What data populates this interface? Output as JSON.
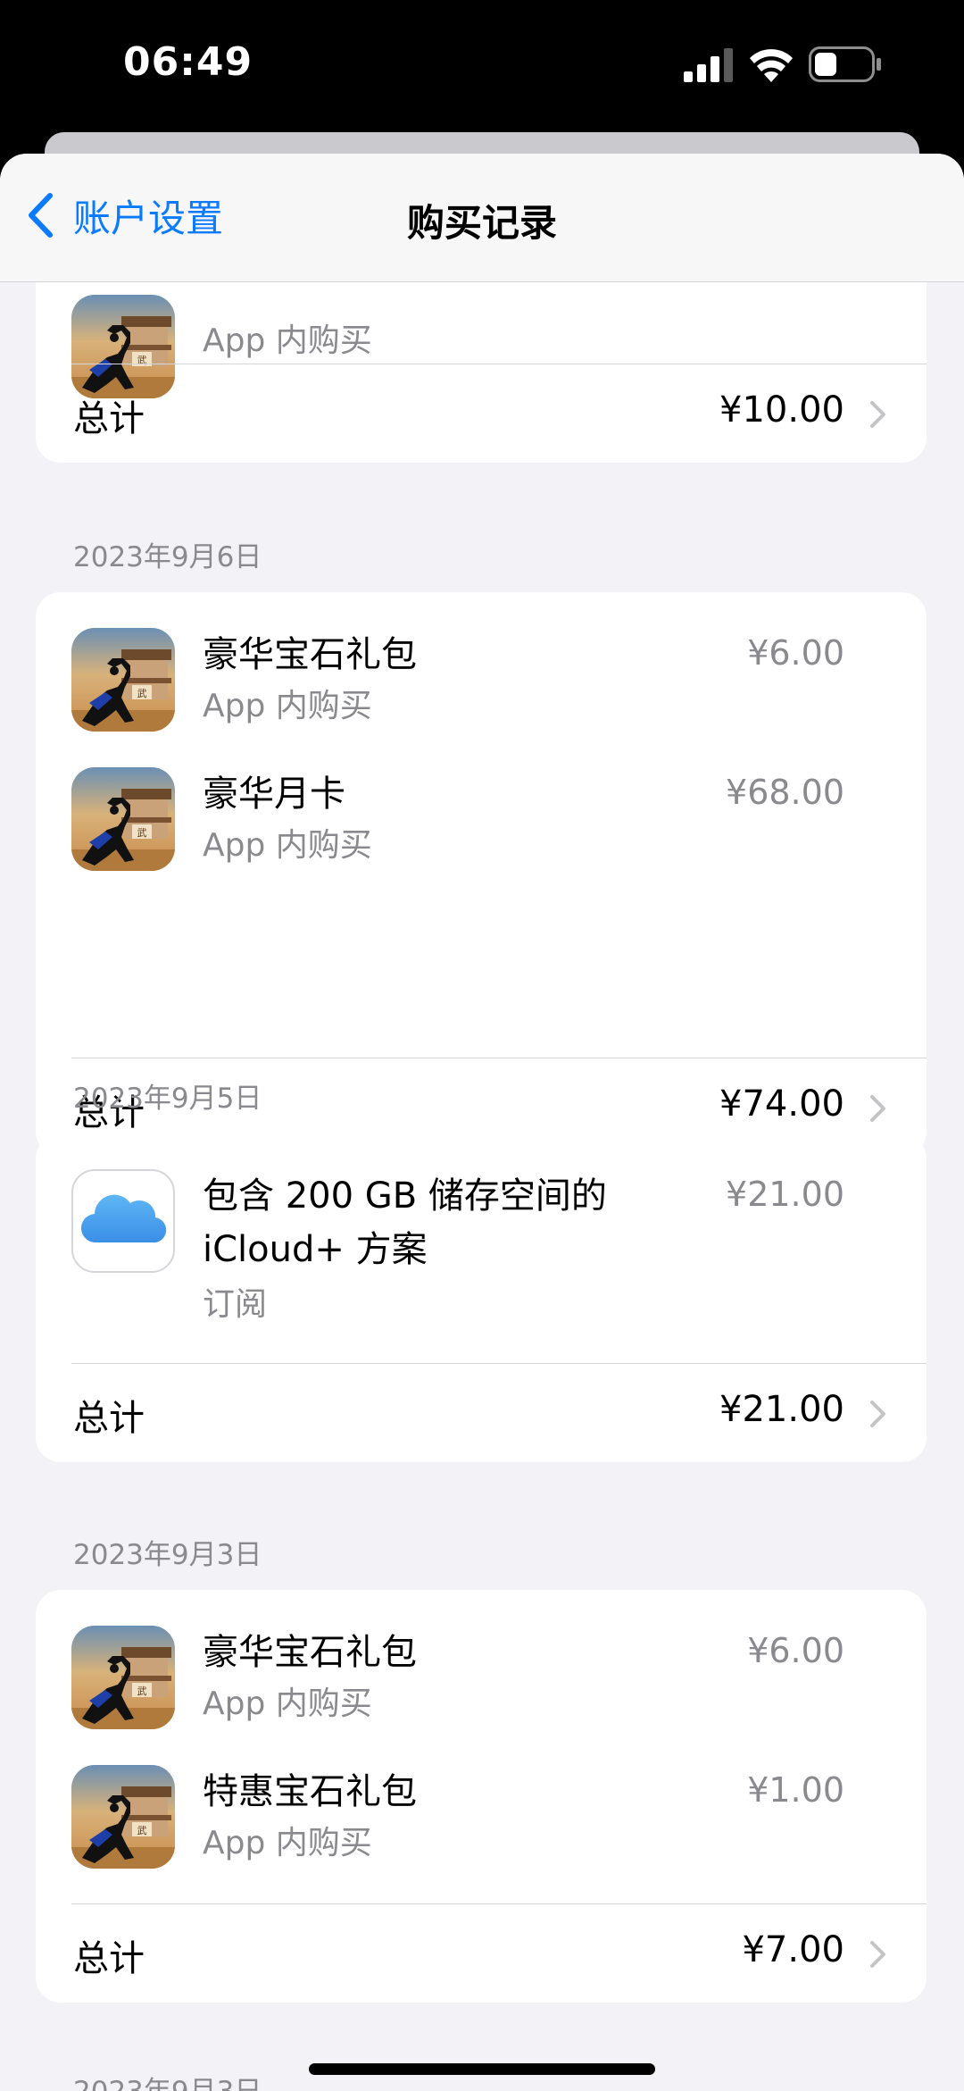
{
  "status_bar": {
    "time": "06:49"
  },
  "nav": {
    "back_label": "账户设置",
    "title": "购买记录"
  },
  "top_partial": {
    "item_sub": "App 内购买",
    "total_label": "总计",
    "total_value": "¥10.00"
  },
  "groups": [
    {
      "date": "2023年9月6日",
      "items": [
        {
          "title": "豪华宝石礼包",
          "sub": "App 内购买",
          "price": "¥6.00",
          "icon": "game-icon"
        },
        {
          "title": "豪华月卡",
          "sub": "App 内购买",
          "price": "¥68.00",
          "icon": "game-icon"
        }
      ],
      "total_label": "总计",
      "total_value": "¥74.00"
    },
    {
      "date": "2023年9月5日",
      "items": [
        {
          "title_line1": "包含 200 GB 储存空间的",
          "title_line2": "iCloud+ 方案",
          "sub": "订阅",
          "price": "¥21.00",
          "icon": "icloud-icon"
        }
      ],
      "total_label": "总计",
      "total_value": "¥21.00"
    },
    {
      "date": "2023年9月3日",
      "items": [
        {
          "title": "豪华宝石礼包",
          "sub": "App 内购买",
          "price": "¥6.00",
          "icon": "game-icon"
        },
        {
          "title": "特惠宝石礼包",
          "sub": "App 内购买",
          "price": "¥1.00",
          "icon": "game-icon"
        }
      ],
      "total_label": "总计",
      "total_value": "¥7.00"
    }
  ],
  "bottom_partial": {
    "date": "2023年9月3日"
  },
  "colors": {
    "accent": "#0a7aff",
    "background": "#f2f2f7",
    "secondary_text": "#8a8a8e"
  }
}
